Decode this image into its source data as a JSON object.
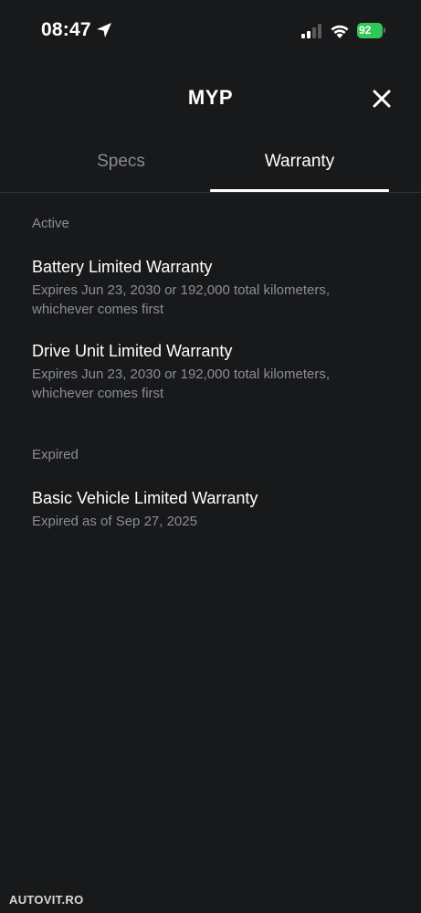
{
  "status_bar": {
    "time": "08:47",
    "battery": "92"
  },
  "header": {
    "title": "MYP"
  },
  "tabs": [
    {
      "label": "Specs",
      "active": false
    },
    {
      "label": "Warranty",
      "active": true
    }
  ],
  "sections": {
    "active": {
      "label": "Active",
      "items": [
        {
          "title": "Battery Limited Warranty",
          "description": "Expires Jun 23, 2030 or 192,000 total kilometers, whichever comes first"
        },
        {
          "title": "Drive Unit Limited Warranty",
          "description": "Expires Jun 23, 2030 or 192,000 total kilometers, whichever comes first"
        }
      ]
    },
    "expired": {
      "label": "Expired",
      "items": [
        {
          "title": "Basic Vehicle Limited Warranty",
          "description": "Expired as of Sep 27, 2025"
        }
      ]
    }
  },
  "watermark": "AUTOVIT.RO",
  "colors": {
    "background": "#18191b",
    "battery": "#33c759",
    "secondary_text": "#8d8e91"
  }
}
